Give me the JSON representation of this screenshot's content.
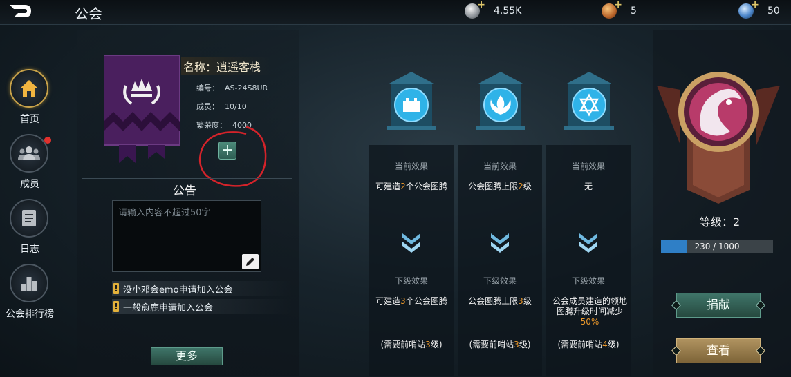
{
  "header": {
    "title": "公会"
  },
  "resources": [
    {
      "icon": "silver-coin-icon",
      "value": "4.55K"
    },
    {
      "icon": "bronze-medal-icon",
      "value": "5"
    },
    {
      "icon": "crystal-orb-icon",
      "value": "50"
    }
  ],
  "sidebar": {
    "items": [
      {
        "label": "首页",
        "icon": "home-icon",
        "active": true
      },
      {
        "label": "成员",
        "icon": "members-icon",
        "badge": true
      },
      {
        "label": "日志",
        "icon": "log-icon"
      },
      {
        "label": "公会排行榜",
        "icon": "ranking-icon"
      }
    ]
  },
  "guild": {
    "name": "名称：逍遥客栈",
    "id_label": "编号：",
    "id_value": "AS-24S8UR",
    "members_label": "成员：",
    "members_value": "10/10",
    "prosperity_label": "繁荣度：",
    "prosperity_value": "4000"
  },
  "notice": {
    "title": "公告",
    "placeholder": "请输入内容不超过50字"
  },
  "applications": [
    {
      "text": "没小邓会emo申请加入公会"
    },
    {
      "text": "一般愈鹿申请加入公会"
    }
  ],
  "more_label": "更多",
  "buildings": [
    {
      "icon": "castle-icon",
      "current_head": "当前效果",
      "current_pre": "可建造",
      "current_num": "2",
      "current_post": "个公会图腾",
      "next_head": "下级效果",
      "next_pre": "可建造",
      "next_num": "3",
      "next_post": "个公会图腾",
      "next_pct": "",
      "req_pre": "(需要前哨站",
      "req_num": "3",
      "req_post": "级)"
    },
    {
      "icon": "flame-totem-icon",
      "current_head": "当前效果",
      "current_pre": "公会图腾上限",
      "current_num": "2",
      "current_post": "级",
      "next_head": "下级效果",
      "next_pre": "公会图腾上限",
      "next_num": "3",
      "next_post": "级",
      "next_pct": "",
      "req_pre": "(需要前哨站",
      "req_num": "3",
      "req_post": "级)"
    },
    {
      "icon": "star-hexagram-icon",
      "current_head": "当前效果",
      "current_pre": "无",
      "current_num": "",
      "current_post": "",
      "next_head": "下级效果",
      "next_pre": "公会成员建造的领地图腾升级时间减少",
      "next_num": "",
      "next_post": "",
      "next_pct": "50%",
      "req_pre": "(需要前哨站",
      "req_num": "4",
      "req_post": "级)"
    }
  ],
  "level": {
    "label": "等级：2",
    "xp_text": "230 / 1000",
    "xp_current": 230,
    "xp_max": 1000
  },
  "actions": {
    "donate": "捐献",
    "view": "查看"
  },
  "colors": {
    "accent_orange": "#e8962b",
    "xp_blue": "#2f7fc6",
    "alert_red": "#e0312d"
  }
}
